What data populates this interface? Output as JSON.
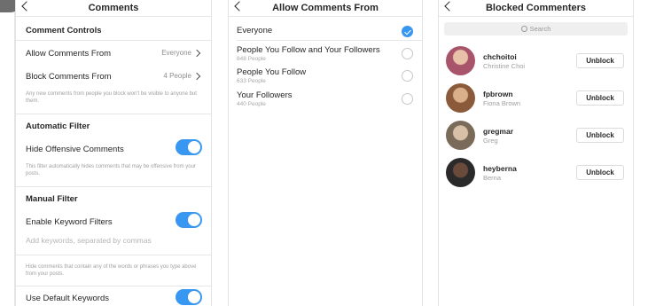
{
  "comments": {
    "title": "Comments",
    "comment_controls": "Comment Controls",
    "allow_label": "Allow Comments From",
    "allow_value": "Everyone",
    "block_label": "Block Comments From",
    "block_value": "4 People",
    "block_help": "Any new comments from people you block won't be visible to anyone but them.",
    "automatic_filter": "Automatic Filter",
    "hide_offensive": "Hide Offensive Comments",
    "hide_help": "This filter automatically hides comments that may be offensive from your posts.",
    "manual_filter": "Manual Filter",
    "enable_keyword": "Enable Keyword Filters",
    "keywords_placeholder": "Add keywords, separated by commas",
    "keywords_help": "Hide comments that contain any of the words or phrases you type above from your posts.",
    "use_default": "Use Default Keywords",
    "toggles": {
      "hide_offensive": true,
      "enable_keyword": true,
      "use_default": true
    }
  },
  "allow": {
    "title": "Allow Comments From",
    "options": [
      {
        "label": "Everyone",
        "sub": "",
        "selected": true
      },
      {
        "label": "People You Follow and Your Followers",
        "sub": "848 People",
        "selected": false
      },
      {
        "label": "People You Follow",
        "sub": "633 People",
        "selected": false
      },
      {
        "label": "Your Followers",
        "sub": "440 People",
        "selected": false
      }
    ]
  },
  "blocked": {
    "title": "Blocked Commenters",
    "search_placeholder": "Search",
    "unblock_label": "Unblock",
    "users": [
      {
        "username": "chchoitoi",
        "name": "Christine Choi",
        "avatar_color": "#a8546a"
      },
      {
        "username": "fpbrown",
        "name": "Fiona Brown",
        "avatar_color": "#8a5a3a"
      },
      {
        "username": "gregmar",
        "name": "Greg",
        "avatar_color": "#7a6a5a"
      },
      {
        "username": "heyberna",
        "name": "Berna",
        "avatar_color": "#2a2a2a"
      }
    ]
  },
  "colors": {
    "accent": "#3897f0",
    "border": "#dbdbdb",
    "muted": "#8e8e8e"
  }
}
